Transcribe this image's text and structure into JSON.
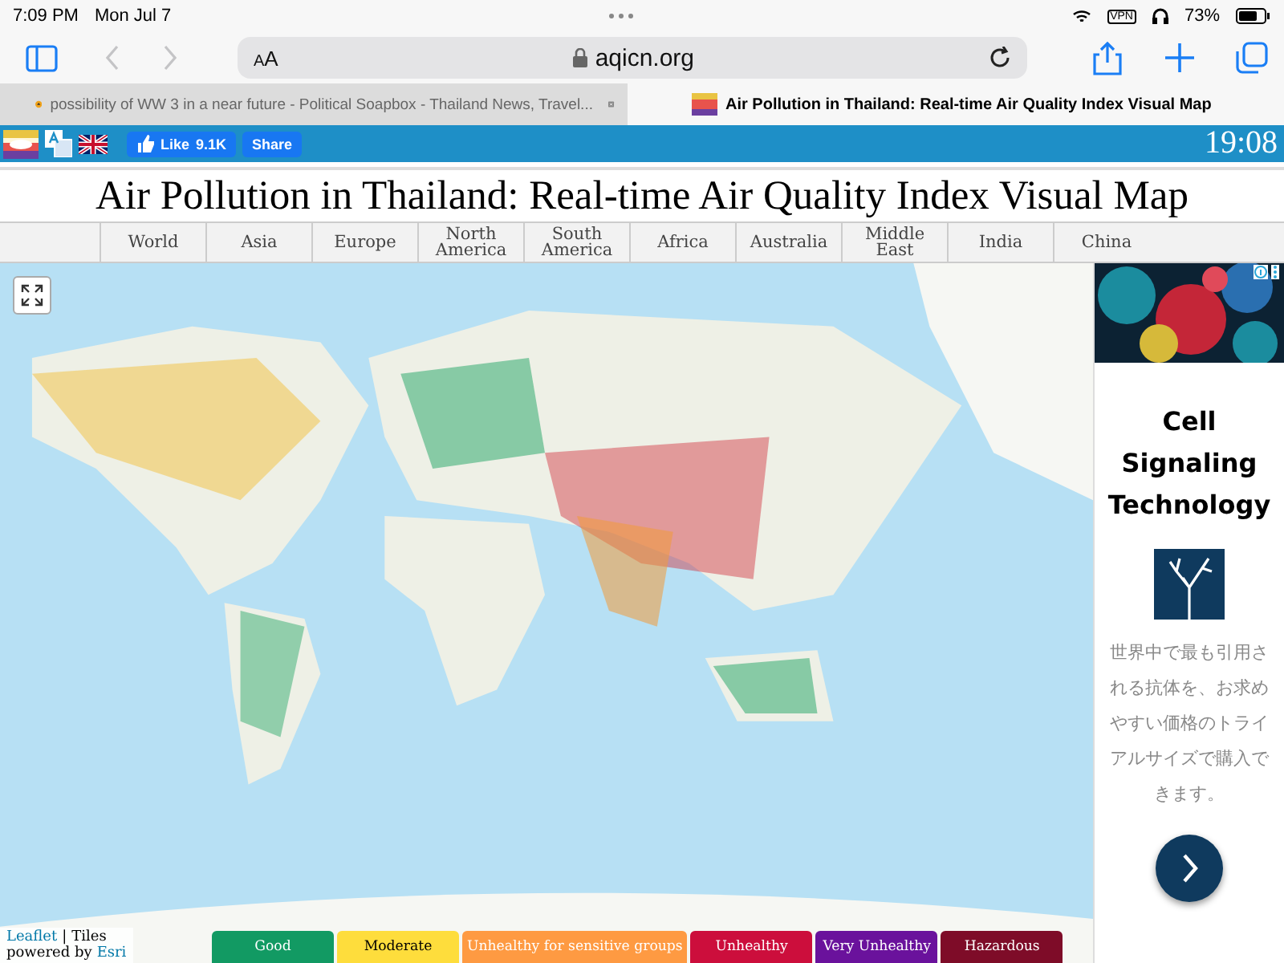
{
  "status_bar": {
    "time": "7:09 PM",
    "date": "Mon Jul 7",
    "vpn": "VPN",
    "battery": "73%"
  },
  "toolbar": {
    "text_size": "AA",
    "address": "aqicn.org"
  },
  "tabs": [
    {
      "title": "possibility of WW 3 in a near future - Political Soapbox - Thailand News, Travel...",
      "selected": false
    },
    {
      "title": "Air Pollution in Thailand: Real-time Air Quality Index Visual Map",
      "selected": true
    }
  ],
  "site_bar": {
    "like_label": "Like",
    "like_count": "9.1K",
    "share": "Share",
    "clock": "19:08"
  },
  "title": "Air Pollution in Thailand: Real-time Air Quality Index Visual Map",
  "regions": [
    {
      "label": "World"
    },
    {
      "label": "Asia"
    },
    {
      "label": "Europe"
    },
    {
      "label": "North America"
    },
    {
      "label": "South America"
    },
    {
      "label": "Africa"
    },
    {
      "label": "Australia"
    },
    {
      "label": "Middle East"
    },
    {
      "label": "India"
    },
    {
      "label": "China"
    }
  ],
  "map": {
    "attribution": {
      "leaflet": "Leaflet",
      "separator": "|",
      "tiles": "Tiles",
      "powered_by": "powered by",
      "esri": "Esri"
    }
  },
  "legend": [
    {
      "label": "Good",
      "color": "#129a63"
    },
    {
      "label": "Moderate",
      "color": "#fedd3c"
    },
    {
      "label": "Unhealthy for sensitive groups",
      "color": "#fe9a42"
    },
    {
      "label": "Unhealthy",
      "color": "#cc0e3c"
    },
    {
      "label": "Very Unhealthy",
      "color": "#6a129c"
    },
    {
      "label": "Hazardous",
      "color": "#7e0c28"
    }
  ],
  "ad": {
    "heading": "Cell Signaling Technology",
    "body": "世界中で最も引用される抗体を、お求めやすい価格のトライアルサイズで購入できます。"
  }
}
